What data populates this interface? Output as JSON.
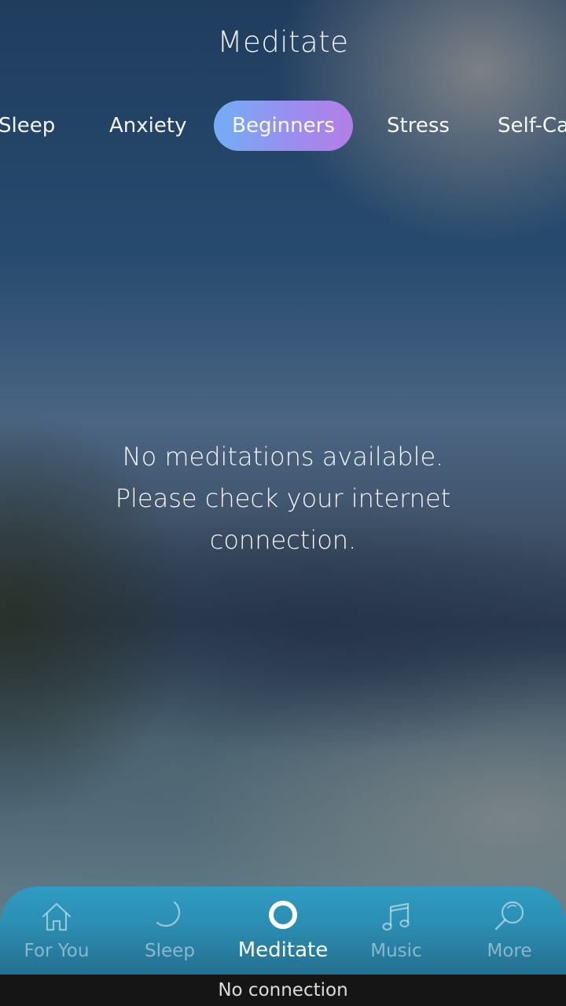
{
  "header": {
    "title": "Meditate"
  },
  "tabs": {
    "items": [
      {
        "label": "Sleep"
      },
      {
        "label": "Anxiety"
      },
      {
        "label": "Beginners"
      },
      {
        "label": "Stress"
      },
      {
        "label": "Self-Ca"
      }
    ],
    "active_index": 2
  },
  "content": {
    "empty_message_lines": [
      "No meditations available.",
      "Please check your internet",
      "connection."
    ]
  },
  "bottom_nav": {
    "items": [
      {
        "label": "For You",
        "icon": "home-icon"
      },
      {
        "label": "Sleep",
        "icon": "moon-icon"
      },
      {
        "label": "Meditate",
        "icon": "ring-icon"
      },
      {
        "label": "Music",
        "icon": "music-note-icon"
      },
      {
        "label": "More",
        "icon": "search-icon"
      }
    ],
    "active_index": 2
  },
  "status": {
    "text": "No connection"
  },
  "colors": {
    "tab_active_start": "#72aef4",
    "tab_active_end": "#b47ee6",
    "nav_bar": "#2b8db1",
    "status_bar": "#151515"
  }
}
